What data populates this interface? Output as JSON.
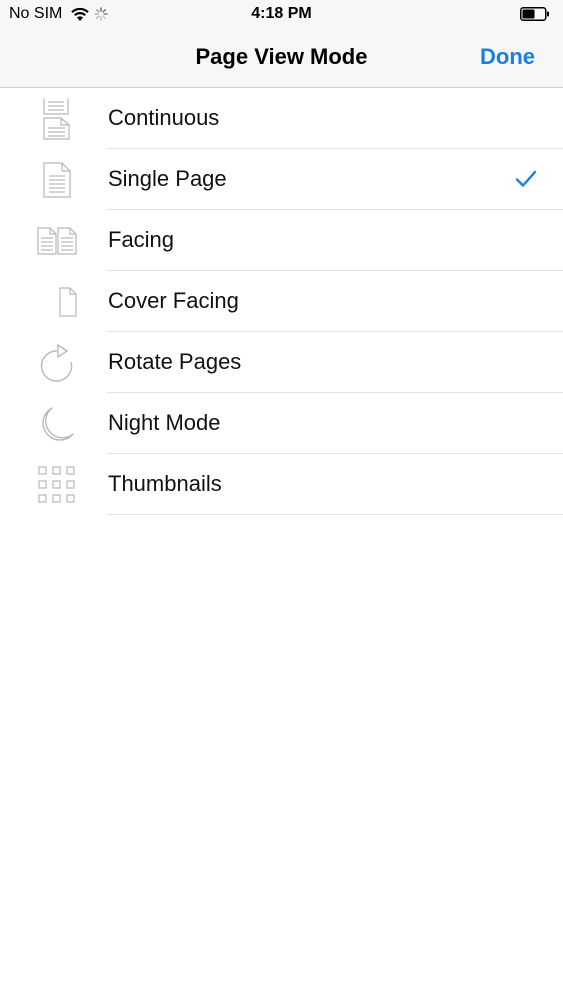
{
  "status_bar": {
    "carrier": "No SIM",
    "time": "4:18 PM"
  },
  "nav": {
    "title": "Page View Mode",
    "done_label": "Done",
    "accent_color": "#1a7fe0"
  },
  "options": [
    {
      "label": "Continuous",
      "icon": "continuous-pages-icon",
      "selected": false
    },
    {
      "label": "Single Page",
      "icon": "single-page-icon",
      "selected": true
    },
    {
      "label": "Facing",
      "icon": "facing-pages-icon",
      "selected": false
    },
    {
      "label": "Cover Facing",
      "icon": "cover-facing-icon",
      "selected": false
    },
    {
      "label": "Rotate Pages",
      "icon": "rotate-icon",
      "selected": false
    },
    {
      "label": "Night Mode",
      "icon": "moon-icon",
      "selected": false
    },
    {
      "label": "Thumbnails",
      "icon": "thumbnails-grid-icon",
      "selected": false
    }
  ]
}
